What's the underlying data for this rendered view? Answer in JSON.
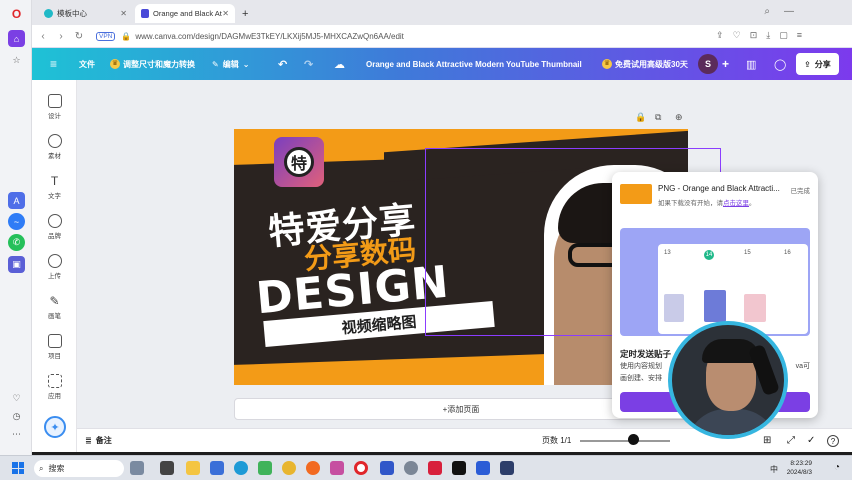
{
  "browser": {
    "tabs": [
      {
        "title": "模板中心"
      },
      {
        "title": "Orange and Black Attra"
      }
    ],
    "new_tab": "+",
    "vpn": "VPN",
    "url": "www.canva.com/design/DAGMwE3TkEY/LKXij5MJ5-MHXCAZwQn6AA/edit"
  },
  "canva_header": {
    "file_label": "文件",
    "resize_label": "调整尺寸和魔力转换",
    "edit_label": "编辑",
    "doc_title": "Orange and Black Attractive Modern YouTube Thumbnail",
    "trial_label": "免费试用高级版30天",
    "avatar_letter": "S",
    "share_label": "分享"
  },
  "tools": [
    {
      "label": "设计"
    },
    {
      "label": "素材"
    },
    {
      "label": "文字"
    },
    {
      "label": "品牌"
    },
    {
      "label": "上传"
    },
    {
      "label": "画笔"
    },
    {
      "label": "项目"
    },
    {
      "label": "应用"
    }
  ],
  "design": {
    "badge_char": "特",
    "line1": "特爱分享",
    "line2": "分享数码",
    "line3": "DESIGN",
    "line4": "视频缩略图",
    "bg_color": "#f39b17"
  },
  "add_page_label": "+添加页面",
  "notification": {
    "title": "PNG - Orange and Black Attracti...",
    "status": "已完成",
    "subtitle_prefix": "如果下载没有开始，请",
    "subtitle_link": "点击这里",
    "subtitle_suffix": "。",
    "calendar_nums": [
      "13",
      "14",
      "15",
      "16"
    ],
    "promo_title": "定时发送贴子",
    "promo_desc_left": "使用内容规划",
    "promo_desc_right": "va可",
    "promo_desc_line2": "画创建、安排"
  },
  "bottombar": {
    "notes_label": "备注",
    "page_label": "页数 1/1"
  },
  "taskbar": {
    "search_label": "搜索",
    "time": "8:23:29",
    "date": "2024/8/3",
    "ime": "中"
  }
}
